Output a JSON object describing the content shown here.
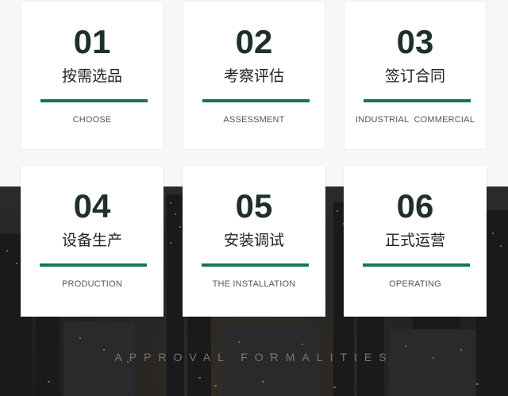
{
  "steps": [
    {
      "number": "01",
      "title": "按需选品",
      "subtitle": "CHOOSE"
    },
    {
      "number": "02",
      "title": "考察评估",
      "subtitle": "ASSESSMENT"
    },
    {
      "number": "03",
      "title": "签订合同",
      "subtitle": "INDUSTRIAL  COMMERCIAL"
    },
    {
      "number": "04",
      "title": "设备生产",
      "subtitle": "PRODUCTION"
    },
    {
      "number": "05",
      "title": "安装调试",
      "subtitle": "THE INSTALLATION"
    },
    {
      "number": "06",
      "title": "正式运营",
      "subtitle": "OPERATING"
    }
  ],
  "footer": {
    "caption": "APPROVAL FORMALITIES"
  },
  "colors": {
    "accent": "#0f7a4c",
    "number": "#1f2f2a",
    "text": "#222222",
    "page_bg": "#f7f7f7"
  }
}
